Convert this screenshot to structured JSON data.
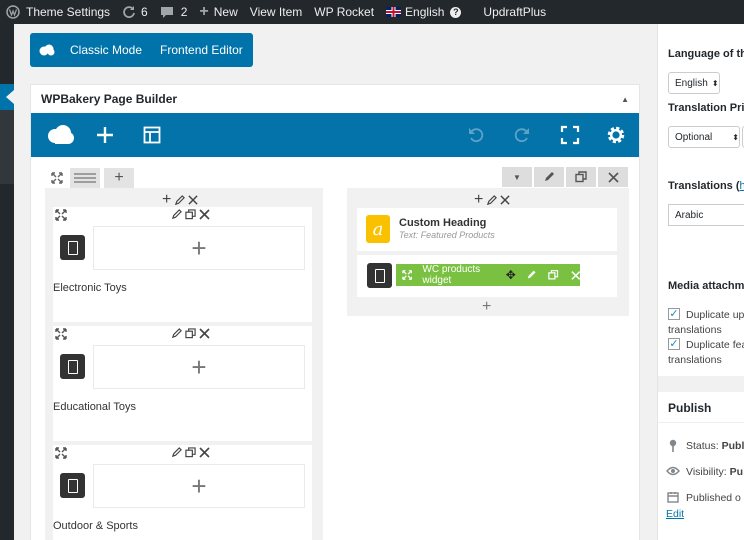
{
  "adminbar": {
    "theme_settings": "Theme Settings",
    "updates_count": "6",
    "comments_count": "2",
    "new_label": "New",
    "view_item": "View Item",
    "wp_rocket": "WP Rocket",
    "language": "English",
    "updraft": "UpdraftPlus"
  },
  "modes": {
    "classic": "Classic Mode",
    "frontend": "Frontend Editor"
  },
  "builder": {
    "title": "WPBakery Page Builder"
  },
  "left_elements": [
    {
      "title": "Electronic Toys"
    },
    {
      "title": "Educational Toys"
    },
    {
      "title": "Outdoor & Sports"
    }
  ],
  "right_column": {
    "heading_title": "Custom Heading",
    "heading_sub": "Text: Featured Products",
    "widget_label": "WC products widget"
  },
  "sidebar": {
    "language_label": "Language of thi",
    "language_value": "English",
    "priority_label": "Translation Prio",
    "priority_value": "Optional",
    "translations_label": "Translations",
    "translations_link": "hi",
    "translations_value": "Arabic",
    "media_label": "Media attachme",
    "dup_uploads_line1": "Duplicate up",
    "dup_uploads_line2": "translations",
    "dup_featured_line1": "Duplicate fea",
    "dup_featured_line2": "translations",
    "publish_title": "Publish",
    "status_label": "Status:",
    "status_value": "Publ",
    "visibility_label": "Visibility:",
    "visibility_value": "Pu",
    "published_label": "Published o",
    "edit_link": "Edit"
  },
  "colors": {
    "adminbar": "#23282d",
    "brand_blue": "#0473aa",
    "widget_green": "#7ac142",
    "heading_yellow": "#f9c100"
  },
  "icons": [
    "wordpress-icon",
    "refresh-icon",
    "comment-icon",
    "plus-icon",
    "flag-icon",
    "help-icon",
    "cloud-icon",
    "add-element-icon",
    "templates-icon",
    "undo-icon",
    "redo-icon",
    "fullscreen-icon",
    "settings-icon",
    "move-icon",
    "edit-icon",
    "clone-icon",
    "close-icon",
    "arrows-expand-icon",
    "calendar-icon",
    "eye-icon",
    "pin-icon"
  ]
}
